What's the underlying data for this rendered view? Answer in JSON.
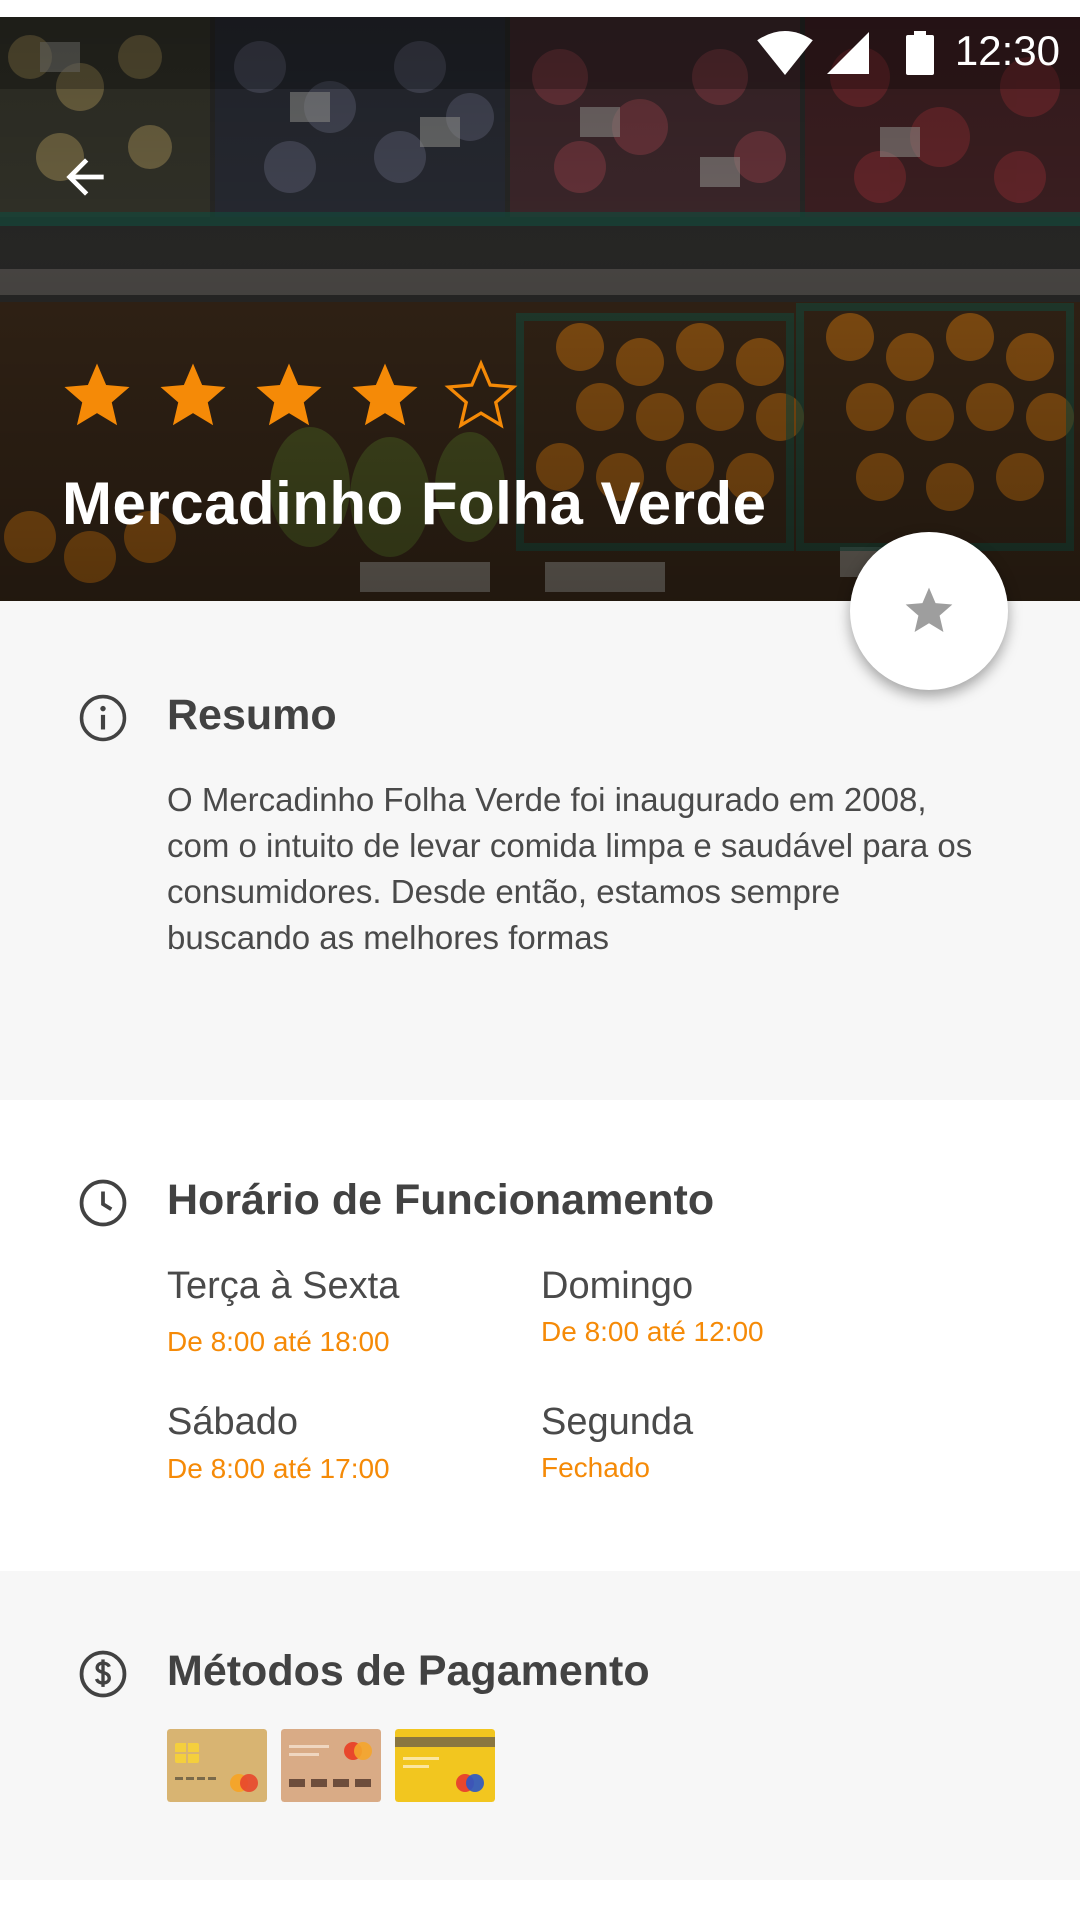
{
  "status_bar": {
    "time": "12:30"
  },
  "hero": {
    "title": "Mercadinho Folha Verde",
    "rating": 4,
    "rating_max": 5,
    "star_color": "#f58a07"
  },
  "summary": {
    "title": "Resumo",
    "text": "O Mercadinho Folha Verde foi inaugurado em 2008, com o intuito de levar comida limpa e saudável para os consumidores. Desde então, estamos sempre buscando as melhores formas"
  },
  "hours": {
    "title": "Horário de Funcionamento",
    "items": [
      {
        "day": "Terça à Sexta",
        "time": "De 8:00 até 18:00"
      },
      {
        "day": "Domingo",
        "time": "De 8:00 até 12:00"
      },
      {
        "day": "Sábado",
        "time": "De 8:00 até 17:00"
      },
      {
        "day": "Segunda",
        "time": "Fechado"
      }
    ]
  },
  "payment": {
    "title": "Métodos de Pagamento",
    "cards": [
      "chip-card-icon",
      "debit-card-icon",
      "credit-card-icon"
    ]
  },
  "colors": {
    "accent": "#f58a07",
    "text": "#424242",
    "section_bg": "#f7f7f7"
  }
}
